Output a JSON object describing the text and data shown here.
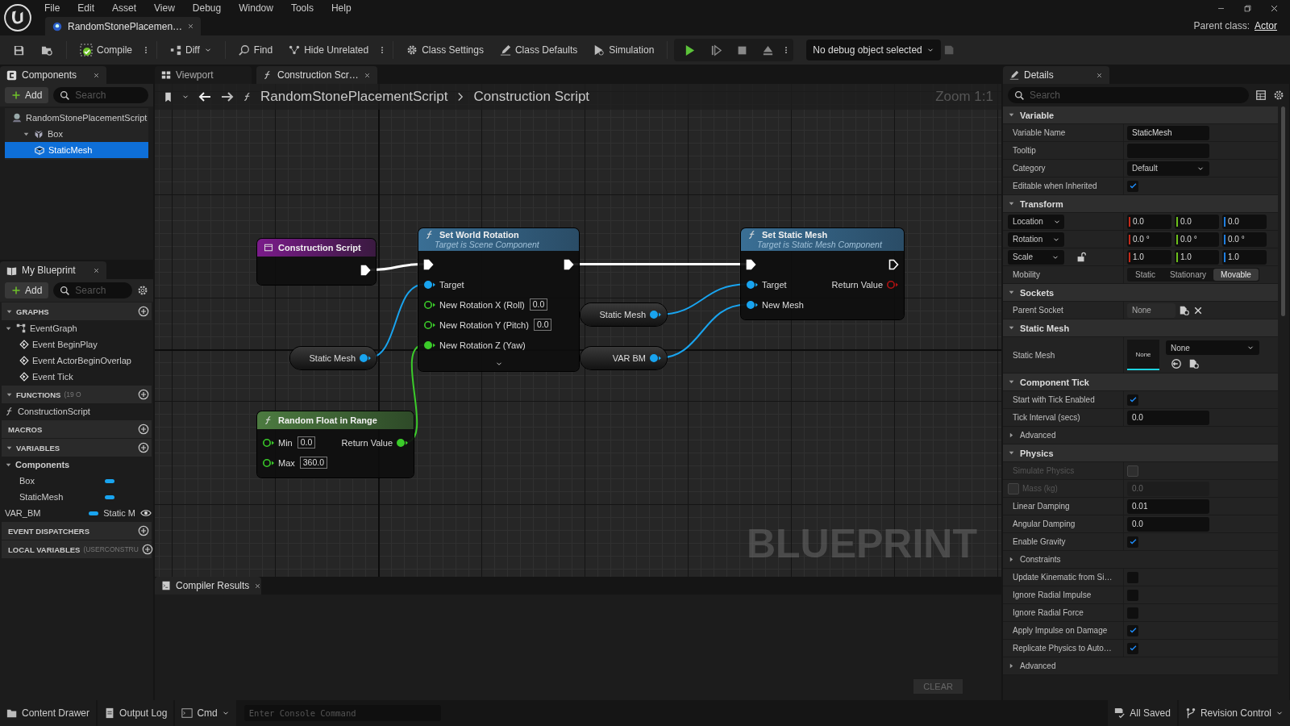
{
  "menu": [
    "File",
    "Edit",
    "Asset",
    "View",
    "Debug",
    "Window",
    "Tools",
    "Help"
  ],
  "document_tab": {
    "title": "RandomStonePlacemen…"
  },
  "parent_class": {
    "label": "Parent class:",
    "value": "Actor"
  },
  "toolbar": {
    "compile": "Compile",
    "diff": "Diff",
    "find": "Find",
    "hide_unrelated": "Hide Unrelated",
    "class_settings": "Class Settings",
    "class_defaults": "Class Defaults",
    "simulation": "Simulation",
    "debug_object": "No debug object selected"
  },
  "components": {
    "title": "Components",
    "add": "Add",
    "search_placeholder": "Search",
    "tree": [
      {
        "label": "RandomStonePlacementScript",
        "selected": false,
        "children": [
          {
            "label": "Box",
            "selected": false,
            "expanded": true,
            "children": [
              {
                "label": "StaticMesh",
                "selected": true
              }
            ]
          }
        ]
      }
    ]
  },
  "my_blueprint": {
    "title": "My Blueprint",
    "add": "Add",
    "search_placeholder": "Search",
    "sections": [
      {
        "title": "GRAPHS",
        "expanded": true,
        "items": [
          {
            "label": "EventGraph",
            "expanded": true,
            "children": [
              {
                "label": "Event BeginPlay"
              },
              {
                "label": "Event ActorBeginOverlap"
              },
              {
                "label": "Event Tick"
              }
            ]
          }
        ]
      },
      {
        "title": "FUNCTIONS",
        "note": "(19 O",
        "expanded": true,
        "items": [
          {
            "label": "ConstructionScript"
          }
        ]
      },
      {
        "title": "MACROS",
        "expanded": false
      },
      {
        "title": "VARIABLES",
        "expanded": true,
        "items": [
          {
            "label": "Components",
            "expanded": true,
            "children": [
              {
                "label": "Box"
              },
              {
                "label": "StaticMesh"
              }
            ]
          },
          {
            "label": "VAR_BM",
            "type": "Static M"
          }
        ]
      },
      {
        "title": "EVENT DISPATCHERS",
        "expanded": false
      },
      {
        "title": "LOCAL VARIABLES",
        "note": "(USERCONSTRU",
        "expanded": false
      }
    ]
  },
  "graph": {
    "tabs": [
      {
        "label": "Viewport",
        "selected": false
      },
      {
        "label": "Construction Scr…",
        "selected": true
      }
    ],
    "breadcrumb": [
      "RandomStonePlacementScript",
      "Construction Script"
    ],
    "zoom": "Zoom 1:1",
    "watermark": "BLUEPRINT",
    "nodes": [
      {
        "kind": "event",
        "title": "Construction Script",
        "outputs": [
          {
            "kind": "exec",
            "connected": true
          }
        ]
      },
      {
        "kind": "function",
        "title": "Set World Rotation",
        "subtitle": "Target is Scene Component",
        "advanced": true,
        "inputs": [
          {
            "kind": "exec",
            "connected": true
          },
          {
            "kind": "object",
            "label": "Target",
            "connected": true
          },
          {
            "kind": "float",
            "label": "New Rotation X (Roll)",
            "value": "0.0",
            "connected": false
          },
          {
            "kind": "float",
            "label": "New Rotation Y (Pitch)",
            "value": "0.0",
            "connected": false
          },
          {
            "kind": "float",
            "label": "New Rotation Z (Yaw)",
            "connected": true
          }
        ],
        "outputs": [
          {
            "kind": "exec",
            "connected": true
          }
        ]
      },
      {
        "kind": "function",
        "title": "Set Static Mesh",
        "subtitle": "Target is Static Mesh Component",
        "advanced": false,
        "inputs": [
          {
            "kind": "exec",
            "connected": true
          },
          {
            "kind": "object",
            "label": "Target",
            "connected": true
          },
          {
            "kind": "object",
            "label": "New Mesh",
            "connected": true
          }
        ],
        "outputs": [
          {
            "kind": "exec",
            "connected": false
          },
          {
            "kind": "bool",
            "label": "Return Value",
            "connected": false
          }
        ]
      },
      {
        "kind": "getter",
        "title": "Static Mesh",
        "outputs": [
          {
            "kind": "object",
            "connected": true
          }
        ]
      },
      {
        "kind": "getter",
        "title": "Static Mesh",
        "outputs": [
          {
            "kind": "object",
            "connected": true
          }
        ]
      },
      {
        "kind": "getter",
        "title": "VAR BM",
        "outputs": [
          {
            "kind": "object",
            "connected": true
          }
        ]
      },
      {
        "kind": "pure",
        "title": "Random Float in Range",
        "inputs": [
          {
            "kind": "float",
            "label": "Min",
            "value": "0.0",
            "connected": false
          },
          {
            "kind": "float",
            "label": "Max",
            "value": "360.0",
            "connected": false
          }
        ],
        "outputs": [
          {
            "kind": "float",
            "label": "Return Value",
            "connected": true
          }
        ]
      }
    ]
  },
  "compiler_results": {
    "title": "Compiler Results",
    "clear": "CLEAR"
  },
  "details": {
    "title": "Details",
    "search_placeholder": "Search",
    "sections": [
      {
        "title": "Variable",
        "expanded": true,
        "rows": [
          {
            "kind": "text",
            "label": "Variable Name",
            "value": "StaticMesh"
          },
          {
            "kind": "text",
            "label": "Tooltip"
          },
          {
            "kind": "dropdown",
            "label": "Category",
            "value": "Default"
          },
          {
            "kind": "check",
            "label": "Editable when Inherited",
            "checked": true
          }
        ]
      },
      {
        "title": "Transform",
        "expanded": true,
        "rows": [
          {
            "kind": "vector",
            "label": "Location",
            "values": [
              "0.0",
              "0.0",
              "0.0"
            ]
          },
          {
            "kind": "vector",
            "label": "Rotation",
            "values": [
              "0.0 °",
              "0.0 °",
              "0.0 °"
            ]
          },
          {
            "kind": "vector",
            "label": "Scale",
            "values": [
              "1.0",
              "1.0",
              "1.0"
            ],
            "locked": false
          },
          {
            "kind": "segmented",
            "label": "Mobility",
            "options": [
              {
                "label": "Static",
                "selected": false
              },
              {
                "label": "Stationary",
                "selected": false
              },
              {
                "label": "Movable",
                "selected": true
              }
            ]
          }
        ]
      },
      {
        "title": "Sockets",
        "expanded": true,
        "rows": [
          {
            "kind": "socket",
            "label": "Parent Socket",
            "value": "None"
          }
        ]
      },
      {
        "title": "Static Mesh",
        "expanded": true,
        "rows": [
          {
            "kind": "asset",
            "label": "Static Mesh",
            "thumbnail": "None",
            "value": "None"
          }
        ]
      },
      {
        "title": "Component Tick",
        "expanded": true,
        "rows": [
          {
            "kind": "check",
            "label": "Start with Tick Enabled",
            "checked": true
          },
          {
            "kind": "text",
            "label": "Tick Interval (secs)",
            "value": "0.0"
          },
          {
            "kind": "group",
            "label": "Advanced",
            "expanded": false
          }
        ]
      },
      {
        "title": "Physics",
        "expanded": true,
        "rows": [
          {
            "kind": "check",
            "label": "Simulate Physics",
            "checked": false,
            "disabled": true
          },
          {
            "kind": "override_text",
            "label": "Mass (kg)",
            "value": "0.0",
            "checked": false,
            "disabled": true
          },
          {
            "kind": "text",
            "label": "Linear Damping",
            "value": "0.01",
            "disabled": false
          },
          {
            "kind": "text",
            "label": "Angular Damping",
            "value": "0.0",
            "disabled": false
          },
          {
            "kind": "check",
            "label": "Enable Gravity",
            "checked": true,
            "disabled": false
          },
          {
            "kind": "group",
            "label": "Constraints",
            "expanded": false,
            "disabled": false
          },
          {
            "kind": "check",
            "label": "Update Kinematic from Si…",
            "checked": false,
            "disabled": false
          },
          {
            "kind": "check",
            "label": "Ignore Radial Impulse",
            "checked": false,
            "disabled": false
          },
          {
            "kind": "check",
            "label": "Ignore Radial Force",
            "checked": false,
            "disabled": false
          },
          {
            "kind": "check",
            "label": "Apply Impulse on Damage",
            "checked": true,
            "disabled": false
          },
          {
            "kind": "check",
            "label": "Replicate Physics to Auto…",
            "checked": true,
            "disabled": false
          },
          {
            "kind": "group",
            "label": "Advanced",
            "expanded": false,
            "disabled": false
          }
        ]
      }
    ]
  },
  "status_bar": {
    "content_drawer": "Content Drawer",
    "output_log": "Output Log",
    "cmd": "Cmd",
    "console_placeholder": "Enter Console Command",
    "saved": "All Saved",
    "revision_control": "Revision Control"
  }
}
